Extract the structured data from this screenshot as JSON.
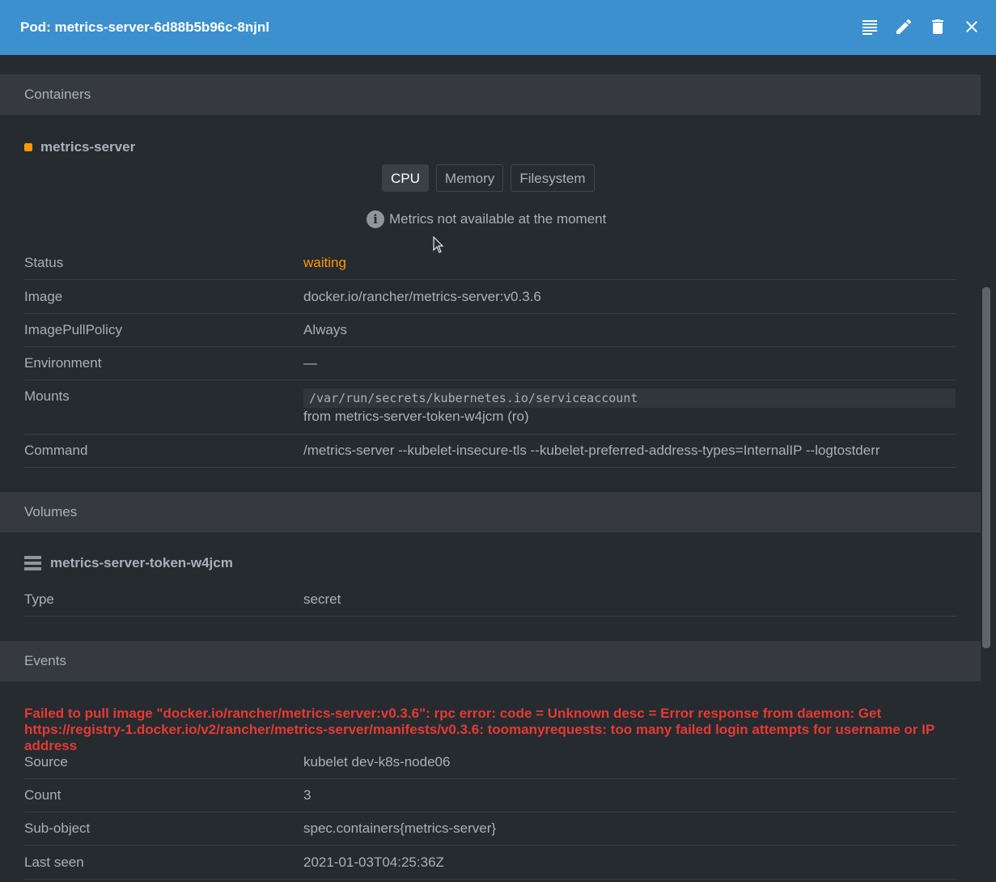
{
  "header": {
    "title": "Pod: metrics-server-6d88b5b96c-8njnl",
    "actions": [
      "logs-icon",
      "edit-icon",
      "delete-icon",
      "close-icon"
    ]
  },
  "containers": {
    "section_title": "Containers",
    "name": "metrics-server",
    "status_dot_color": "#ff9800",
    "tabs": [
      {
        "label": "CPU",
        "active": true
      },
      {
        "label": "Memory",
        "active": false
      },
      {
        "label": "Filesystem",
        "active": false
      }
    ],
    "metrics_notice": "Metrics not available at the moment",
    "rows": {
      "status": {
        "key": "Status",
        "value": "waiting",
        "value_color": "#ff9800"
      },
      "image": {
        "key": "Image",
        "value": "docker.io/rancher/metrics-server:v0.3.6"
      },
      "pull_policy": {
        "key": "ImagePullPolicy",
        "value": "Always"
      },
      "environment": {
        "key": "Environment",
        "value": "—"
      },
      "mounts": {
        "key": "Mounts",
        "path": "/var/run/secrets/kubernetes.io/serviceaccount",
        "from": "from metrics-server-token-w4jcm (ro)"
      },
      "command": {
        "key": "Command",
        "value": "/metrics-server --kubelet-insecure-tls --kubelet-preferred-address-types=InternalIP --logtostderr"
      }
    }
  },
  "volumes": {
    "section_title": "Volumes",
    "name": "metrics-server-token-w4jcm",
    "type_key": "Type",
    "type_value": "secret"
  },
  "events": {
    "section_title": "Events",
    "message": "Failed to pull image \"docker.io/rancher/metrics-server:v0.3.6\": rpc error: code = Unknown desc = Error response from daemon: Get https://registry-1.docker.io/v2/rancher/metrics-server/manifests/v0.3.6: toomanyrequests: too many failed login attempts for username or IP address",
    "message_color": "#e53935",
    "rows": {
      "source": {
        "key": "Source",
        "value": "kubelet dev-k8s-node06"
      },
      "count": {
        "key": "Count",
        "value": "3"
      },
      "subobject": {
        "key": "Sub-object",
        "value": "spec.containers{metrics-server}"
      },
      "last_seen": {
        "key": "Last seen",
        "value": "2021-01-03T04:25:36Z"
      }
    }
  }
}
